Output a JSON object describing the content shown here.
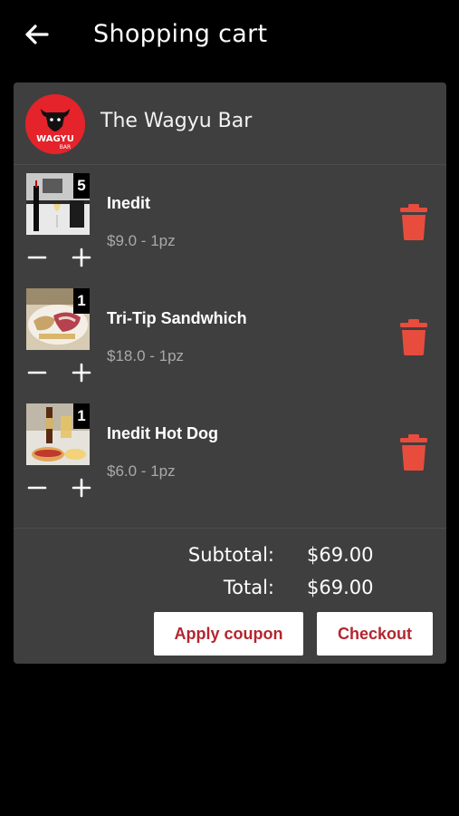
{
  "header": {
    "title": "Shopping cart",
    "back_icon": "arrow-left-icon"
  },
  "store": {
    "name": "The Wagyu Bar",
    "logo_text": "WAGYU",
    "logo_subtext": "BAR",
    "logo_color": "#e4232b"
  },
  "items": [
    {
      "name": "Inedit",
      "price": "$9.0 - 1pz",
      "qty": "5"
    },
    {
      "name": "Tri-Tip Sandwhich",
      "price": "$18.0 - 1pz",
      "qty": "1"
    },
    {
      "name": "Inedit Hot Dog",
      "price": "$6.0 - 1pz",
      "qty": "1"
    }
  ],
  "summary": {
    "subtotal_label": "Subtotal:",
    "subtotal_value": "$69.00",
    "total_label": "Total:",
    "total_value": "$69.00"
  },
  "actions": {
    "coupon_label": "Apply coupon",
    "checkout_label": "Checkout"
  },
  "colors": {
    "accent": "#e84c3d",
    "button_text": "#b3262f",
    "card_bg": "#3f3f3f"
  }
}
